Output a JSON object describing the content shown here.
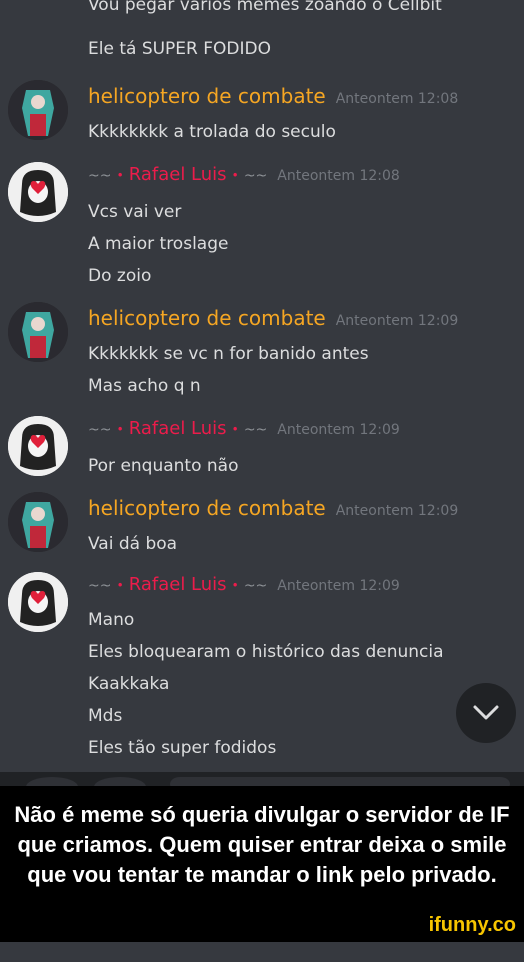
{
  "previous": {
    "lines": [
      "Vou pegar vários memes zoando o Cellbit",
      "Ele tá SUPER FODIDO"
    ]
  },
  "messages": [
    {
      "type": "heli",
      "name": "helicoptero de combate",
      "time": "Anteontem 12:08",
      "lines": [
        "Kkkkkkkk a trolada do seculo"
      ]
    },
    {
      "type": "rafa",
      "name": "Rafael Luis",
      "time": "Anteontem 12:08",
      "lines": [
        "Vcs vai ver",
        "A maior troslage",
        "Do zoio"
      ]
    },
    {
      "type": "heli",
      "name": "helicoptero de combate",
      "time": "Anteontem 12:09",
      "lines": [
        "Kkkkkkk se vc n for banido antes",
        "Mas acho q n"
      ]
    },
    {
      "type": "rafa",
      "name": "Rafael Luis",
      "time": "Anteontem 12:09",
      "lines": [
        "Por enquanto não"
      ]
    },
    {
      "type": "heli",
      "name": "helicoptero de combate",
      "time": "Anteontem 12:09",
      "lines": [
        "Vai dá boa"
      ]
    },
    {
      "type": "rafa",
      "name": "Rafael Luis",
      "time": "Anteontem 12:09",
      "lines": [
        "Mano",
        "Eles bloquearam o histórico das denuncia",
        "Kaakkaka",
        "Mds",
        "Eles tão super fodidos"
      ]
    }
  ],
  "decor": {
    "tilde": "~~",
    "dot": "•"
  },
  "caption": {
    "text": "Não é meme só queria divulgar o servidor de IF que criamos. Quem quiser entrar deixa o smile que vou tentar te mandar o link pelo privado."
  },
  "watermark": {
    "text": "ifunny.co"
  },
  "icons": {
    "scroll": "chevron-down-icon"
  },
  "colors": {
    "heli_name": "#f5a623",
    "rafa_name": "#ec1c4b",
    "background": "#36393f"
  }
}
